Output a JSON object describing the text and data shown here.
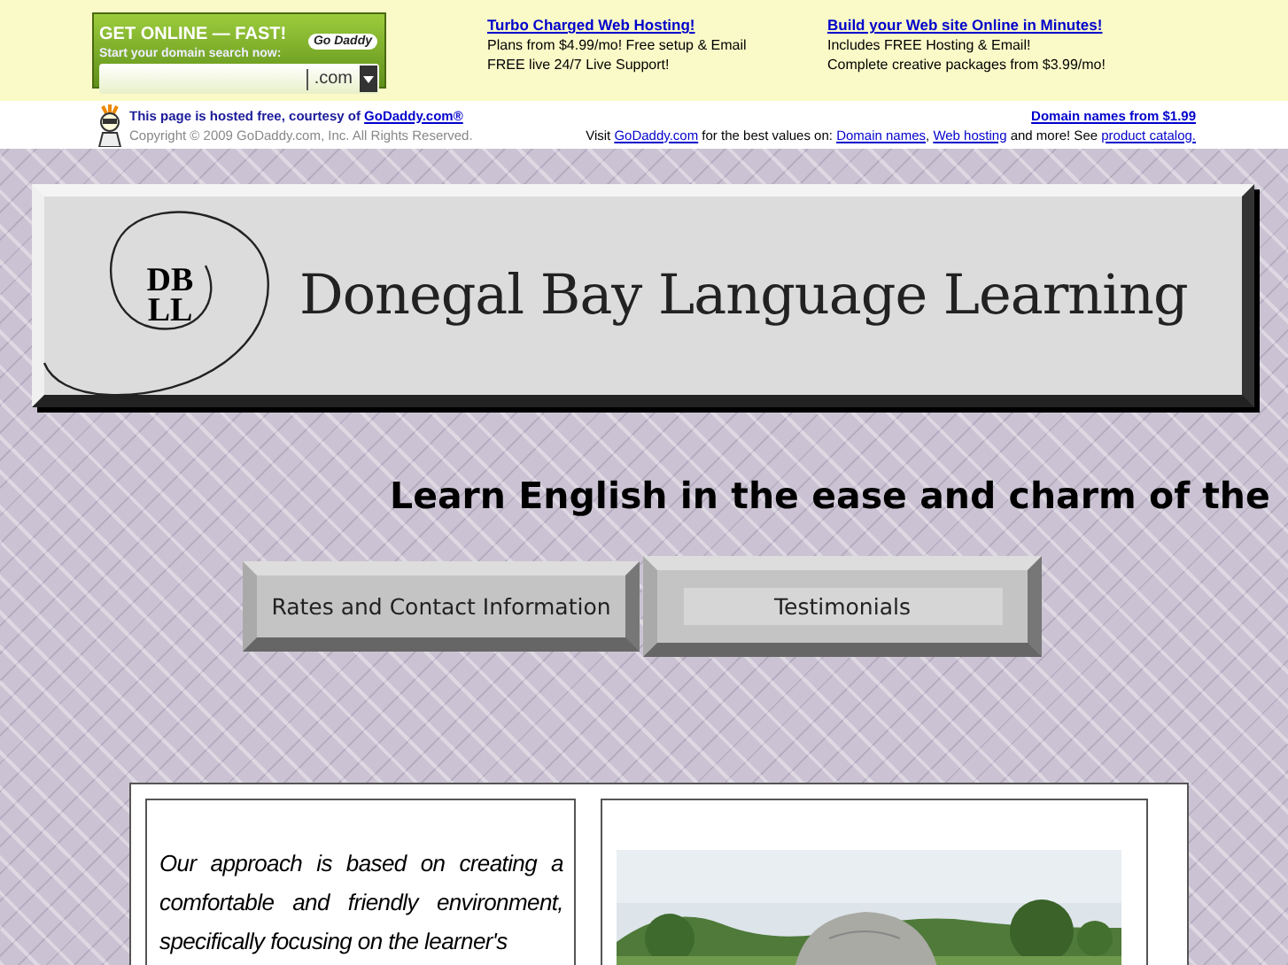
{
  "banner": {
    "widget": {
      "headline": "GET ONLINE — FAST!",
      "subline": "Start your domain search now:",
      "brand": "Go Daddy",
      "suffix": ".com"
    },
    "ads": [
      {
        "title": "Turbo Charged Web Hosting!",
        "lines": [
          "Plans from $4.99/mo! Free setup & Email",
          "FREE live 24/7 Live Support!"
        ]
      },
      {
        "title": "Build your Web site Online in Minutes!",
        "lines": [
          "Includes FREE Hosting & Email!",
          "Complete creative packages from $3.99/mo!"
        ]
      }
    ]
  },
  "hosted_bar": {
    "notice": "This page is hosted free, courtesy of",
    "notice_link": "GoDaddy.com®",
    "copyright": "Copyright © 2009 GoDaddy.com, Inc. All Rights Reserved.",
    "promo_link": "Domain names from $1.99",
    "visit": [
      {
        "kind": "text",
        "text": "Visit "
      },
      {
        "kind": "link",
        "text": "GoDaddy.com"
      },
      {
        "kind": "text",
        "text": " for the best values on: "
      },
      {
        "kind": "link",
        "text": "Domain names"
      },
      {
        "kind": "text",
        "text": ", "
      },
      {
        "kind": "link",
        "text": "Web hosting"
      },
      {
        "kind": "text",
        "text": " and more! See "
      },
      {
        "kind": "link",
        "text": "product catalog."
      }
    ]
  },
  "logo": {
    "monogram_top": "DB",
    "monogram_bottom": "LL",
    "title": "Donegal Bay Language Learning"
  },
  "heading": "Learn English in the ease and charm of the",
  "nav": [
    {
      "label": "Rates and Contact Information",
      "selected": false
    },
    {
      "label": "Testimonials",
      "selected": true
    }
  ],
  "content": {
    "paragraph": "Our approach is based on creating a comfortable and friendly environment, specifically focusing on the learner's"
  }
}
